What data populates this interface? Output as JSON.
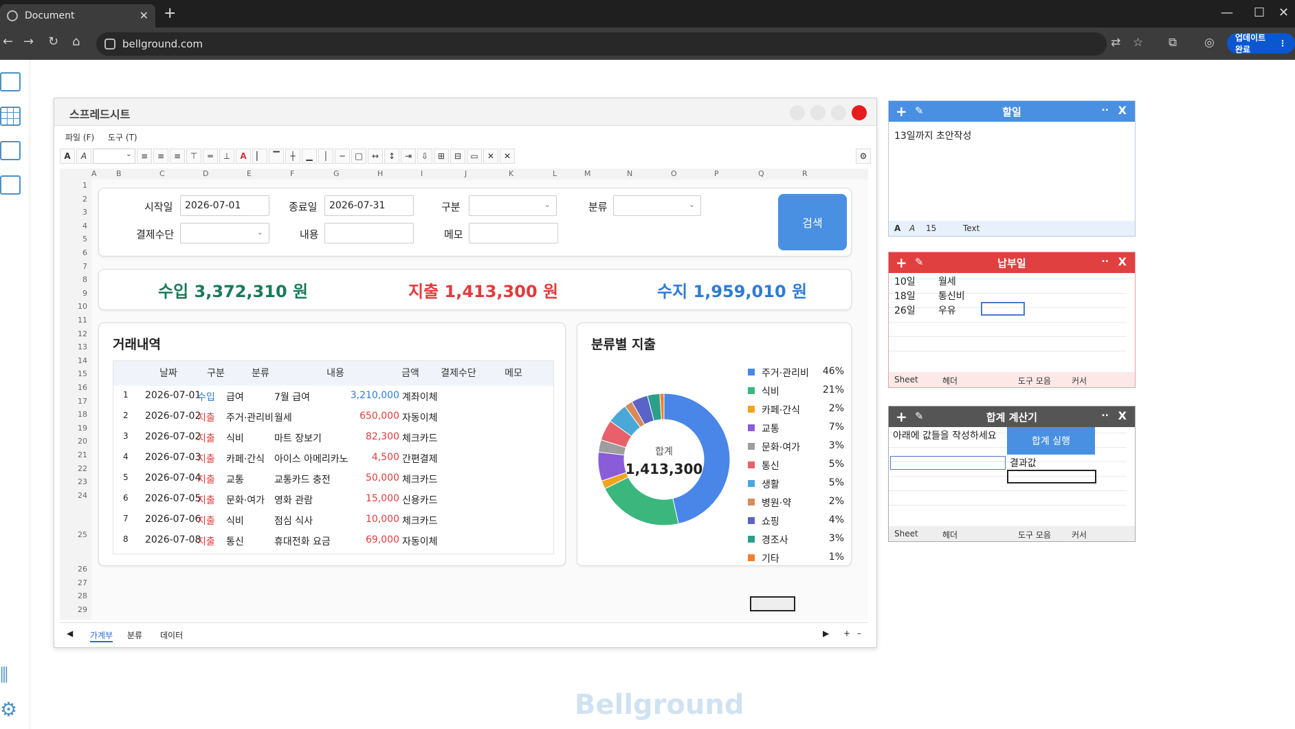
{
  "browser": {
    "tab_title": "Document",
    "url": "bellground.com",
    "update_label": "업데이트 완료"
  },
  "brand": {
    "watermark": "Bellground"
  },
  "sheet": {
    "title": "스프레드시트",
    "menu": {
      "file": "파일 (F)",
      "tools": "도구 (T)"
    },
    "columns": [
      "A",
      "B",
      "C",
      "D",
      "E",
      "F",
      "G",
      "H",
      "I",
      "J",
      "K",
      "L",
      "M",
      "N",
      "O",
      "P",
      "Q",
      "R"
    ],
    "rows": [
      "1",
      "2",
      "3",
      "4",
      "5",
      "6",
      "7",
      "8",
      "9",
      "10",
      "11",
      "12",
      "13",
      "14",
      "15",
      "16",
      "17",
      "18",
      "19",
      "20",
      "21",
      "22",
      "23",
      "24",
      "25",
      "26",
      "27",
      "28",
      "29"
    ],
    "search": {
      "start_label": "시작일",
      "start_value": "2026-07-01",
      "end_label": "종료일",
      "end_value": "2026-07-31",
      "type_label": "구분",
      "category_label": "분류",
      "payment_label": "결제수단",
      "content_label": "내용",
      "memo_label": "메모",
      "search_button": "검색"
    },
    "summary": {
      "income": "수입 3,372,310 원",
      "expense": "지출 1,413,300 원",
      "balance": "수지 1,959,010 원",
      "colors": {
        "income": "#1a7a5a",
        "expense": "#e23b3b",
        "balance": "#2e7bd6"
      }
    },
    "transactions": {
      "title": "거래내역",
      "headers": [
        "날짜",
        "구분",
        "분류",
        "내용",
        "금액",
        "결제수단",
        "메모"
      ],
      "rows": [
        {
          "no": "1",
          "date": "2026-07-01",
          "type": "수입",
          "cat": "급여",
          "desc": "7월 급여",
          "amount": "3,210,000",
          "pay": "계좌이체"
        },
        {
          "no": "2",
          "date": "2026-07-02",
          "type": "지출",
          "cat": "주거·관리비",
          "desc": "월세",
          "amount": "650,000",
          "pay": "자동이체"
        },
        {
          "no": "3",
          "date": "2026-07-02",
          "type": "지출",
          "cat": "식비",
          "desc": "마트 장보기",
          "amount": "82,300",
          "pay": "체크카드"
        },
        {
          "no": "4",
          "date": "2026-07-03",
          "type": "지출",
          "cat": "카페·간식",
          "desc": "아이스 아메리카노",
          "amount": "4,500",
          "pay": "간편결제"
        },
        {
          "no": "5",
          "date": "2026-07-04",
          "type": "지출",
          "cat": "교통",
          "desc": "교통카드 충전",
          "amount": "50,000",
          "pay": "체크카드"
        },
        {
          "no": "6",
          "date": "2026-07-05",
          "type": "지출",
          "cat": "문화·여가",
          "desc": "영화 관람",
          "amount": "15,000",
          "pay": "신용카드"
        },
        {
          "no": "7",
          "date": "2026-07-06",
          "type": "지출",
          "cat": "식비",
          "desc": "점심 식사",
          "amount": "10,000",
          "pay": "체크카드"
        },
        {
          "no": "8",
          "date": "2026-07-08",
          "type": "지출",
          "cat": "통신",
          "desc": "휴대전화 요금",
          "amount": "69,000",
          "pay": "자동이체"
        }
      ]
    },
    "tabs": [
      "가계부",
      "분류",
      "데이터"
    ]
  },
  "chart_data": {
    "type": "pie",
    "title": "분류별 지출",
    "center_label": "합계",
    "center_value": "1,413,300",
    "slices": [
      {
        "name": "주거·관리비",
        "pct_label": "46%",
        "value": 46,
        "color": "#4a86e8"
      },
      {
        "name": "식비",
        "pct_label": "21%",
        "value": 21,
        "color": "#3bb77e"
      },
      {
        "name": "카페·간식",
        "pct_label": "2%",
        "value": 2,
        "color": "#f2a41c"
      },
      {
        "name": "교통",
        "pct_label": "7%",
        "value": 7,
        "color": "#8a5cd8"
      },
      {
        "name": "문화·여가",
        "pct_label": "3%",
        "value": 3,
        "color": "#9e9e9e"
      },
      {
        "name": "통신",
        "pct_label": "5%",
        "value": 5,
        "color": "#e8606a"
      },
      {
        "name": "생활",
        "pct_label": "5%",
        "value": 5,
        "color": "#4aa8d8"
      },
      {
        "name": "병원·약",
        "pct_label": "2%",
        "value": 2,
        "color": "#d88a5a"
      },
      {
        "name": "쇼핑",
        "pct_label": "4%",
        "value": 4,
        "color": "#5a64c8"
      },
      {
        "name": "경조사",
        "pct_label": "3%",
        "value": 3,
        "color": "#2aa08a"
      },
      {
        "name": "기타",
        "pct_label": "1%",
        "value": 1,
        "color": "#f08030"
      }
    ]
  },
  "todo": {
    "title": "할일",
    "text": "13일까지 초안작성",
    "font_size": "15",
    "font_type": "Text",
    "color": "#4a90e2"
  },
  "due": {
    "title": "납부일",
    "color": "#e04040",
    "rows": [
      [
        "10일",
        "월세"
      ],
      [
        "18일",
        "통신비"
      ],
      [
        "26일",
        "우유"
      ]
    ],
    "foot": {
      "sheet": "Sheet",
      "header": "헤더",
      "toolbar": "도구 모음",
      "cursor": "커서"
    }
  },
  "calc": {
    "title": "합계 계산기",
    "color": "#555555",
    "prompt": "아래에 값들을 작성하세요",
    "run": "합계 실행",
    "result": "결과값",
    "foot": {
      "sheet": "Sheet",
      "header": "헤더",
      "toolbar": "도구 모음",
      "cursor": "커서"
    }
  }
}
